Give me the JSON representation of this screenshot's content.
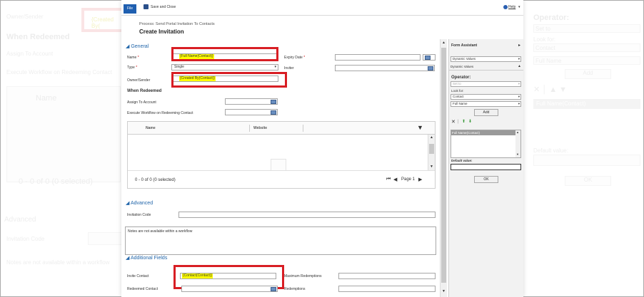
{
  "background": {
    "owner_label": "Owner/Sender",
    "owner_value": "{Created By(",
    "when_redeemed": "When Redeemed",
    "assign_label": "Assign To Account",
    "execute_label": "Execute Workflow on Redeeming Contact",
    "name_col": "Name",
    "count": "0 - 0 of 0 (0 selected)",
    "advanced": "Advanced",
    "invitation_code": "Invitation Code",
    "notes": "Notes are not available within a workflow",
    "operator": "Operator:",
    "set_to": "Set to",
    "look_for": "Look for:",
    "contact": "Contact",
    "full_name": "Full Name",
    "add": "Add",
    "full_name_contact": "Full Name(Contact)",
    "default_value": "Default value:",
    "ok": "OK"
  },
  "toolbar": {
    "file_label": "File",
    "save_close_label": "Save and Close",
    "help_label": "Help"
  },
  "header": {
    "process": "Process: Send Portal Invitation To Contacts",
    "title": "Create Invitation"
  },
  "general": {
    "section_label": "General",
    "name_label": "Name",
    "name_value": "{Full Name(Contact)}",
    "expiry_label": "Expiry Date",
    "type_label": "Type",
    "type_value": "Single",
    "inviter_label": "Inviter",
    "owner_label": "Owner/Sender",
    "owner_value": "{Created By(Contact)}",
    "required_mark": "*"
  },
  "when_redeemed": {
    "heading": "When Redeemed",
    "assign_label": "Assign To Account",
    "execute_label": "Execute Workflow on Redeeming Contact",
    "col_name": "Name",
    "col_website": "Website",
    "count": "0 - 0 of 0 (0 selected)",
    "page": "Page 1"
  },
  "advanced": {
    "section_label": "Advanced",
    "invitation_code_label": "Invitation Code",
    "notes_text": "Notes are not available within a workflow"
  },
  "additional": {
    "section_label": "Additional Fields",
    "invite_contact_label": "Invite Contact",
    "invite_contact_value": "{Contact(Contact)}",
    "max_redemptions_label": "Maximum Redemptions",
    "redeemed_contact_label": "Redeemed Contact",
    "redemptions_label": "Redemptions"
  },
  "form_assistant": {
    "title": "Form Assistant",
    "dynamic_select": "Dynamic Values",
    "dynamic_header": "Dynamic Values",
    "operator_label": "Operator:",
    "operator_value": "Set to",
    "look_for_label": "Look for:",
    "look_for_value": "Contact",
    "field_value": "Full Name",
    "add_label": "Add",
    "list_item": "Full Name(Contact)",
    "default_label": "Default value:",
    "ok_label": "OK"
  }
}
